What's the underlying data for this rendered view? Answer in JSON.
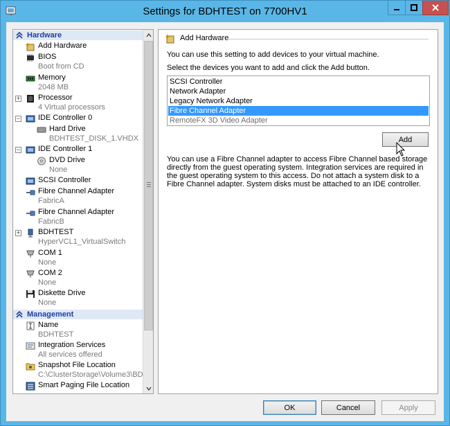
{
  "window": {
    "title": "Settings for BDHTEST on 7700HV1"
  },
  "tree": {
    "hardware_header": "Hardware",
    "management_header": "Management",
    "nodes": [
      {
        "label": "Add Hardware",
        "sub": ""
      },
      {
        "label": "BIOS",
        "sub": "Boot from CD"
      },
      {
        "label": "Memory",
        "sub": "2048 MB"
      },
      {
        "label": "Processor",
        "sub": "4 Virtual processors"
      },
      {
        "label": "IDE Controller 0",
        "sub": ""
      },
      {
        "label": "Hard Drive",
        "sub": "BDHTEST_DISK_1.VHDX"
      },
      {
        "label": "IDE Controller 1",
        "sub": ""
      },
      {
        "label": "DVD Drive",
        "sub": "None"
      },
      {
        "label": "SCSI Controller",
        "sub": ""
      },
      {
        "label": "Fibre Channel Adapter",
        "sub": "FabricA"
      },
      {
        "label": "Fibre Channel Adapter",
        "sub": "FabricB"
      },
      {
        "label": "BDHTEST",
        "sub": "HyperVCL1_VirtualSwitch"
      },
      {
        "label": "COM 1",
        "sub": "None"
      },
      {
        "label": "COM 2",
        "sub": "None"
      },
      {
        "label": "Diskette Drive",
        "sub": "None"
      },
      {
        "label": "Name",
        "sub": "BDHTEST"
      },
      {
        "label": "Integration Services",
        "sub": "All services offered"
      },
      {
        "label": "Snapshot File Location",
        "sub": "C:\\ClusterStorage\\Volume3\\BD..."
      },
      {
        "label": "Smart Paging File Location",
        "sub": ""
      }
    ]
  },
  "panel": {
    "title": "Add Hardware",
    "intro": "You can use this setting to add devices to your virtual machine.",
    "instruction": "Select the devices you want to add and click the Add button.",
    "devices": [
      {
        "label": "SCSI Controller",
        "state": "normal"
      },
      {
        "label": "Network Adapter",
        "state": "normal"
      },
      {
        "label": "Legacy Network Adapter",
        "state": "normal"
      },
      {
        "label": "Fibre Channel Adapter",
        "state": "selected"
      },
      {
        "label": "RemoteFX 3D Video Adapter",
        "state": "disabled"
      }
    ],
    "add_label": "Add",
    "description": "You can use a Fibre Channel adapter to access Fibre Channel based storage directly from the guest operating system. Integration services are required in the guest operating system to this access. Do not attach a system disk to a Fibre Channel adapter. System disks must be attached to an IDE controller."
  },
  "buttons": {
    "ok": "OK",
    "cancel": "Cancel",
    "apply": "Apply"
  },
  "colors": {
    "titlebar": "#5ab6e6",
    "selection": "#3399ff",
    "section_text": "#1f3fa0",
    "close_button": "#c75050"
  }
}
